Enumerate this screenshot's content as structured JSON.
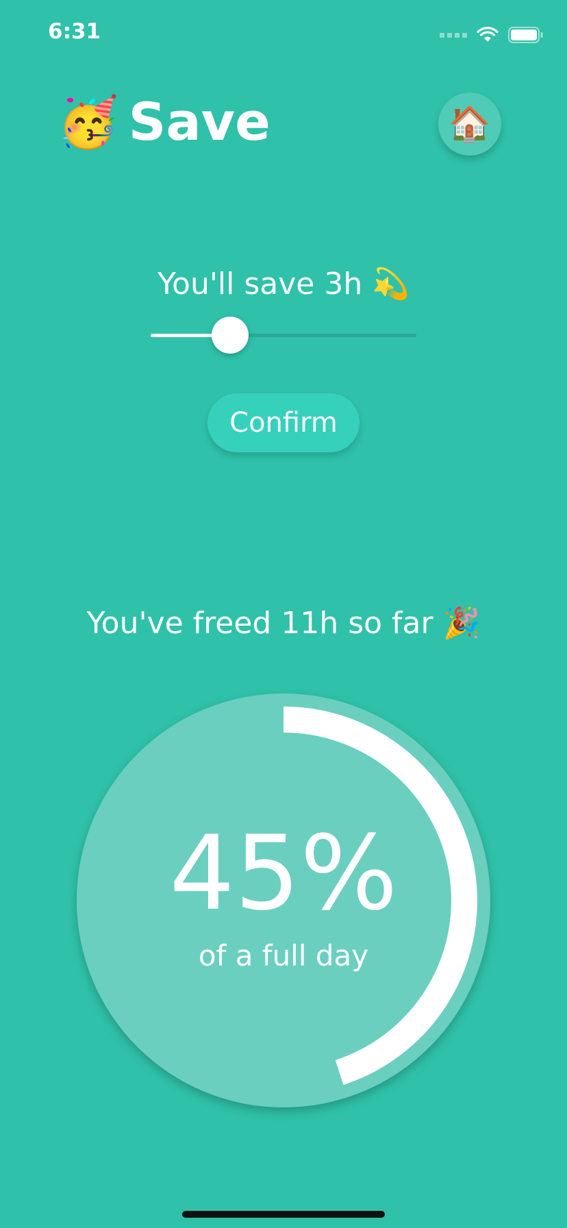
{
  "status_bar": {
    "time": "6:31",
    "signal_icon": "cellular-signal-icon",
    "wifi_icon": "wifi-icon",
    "battery_icon": "battery-icon"
  },
  "header": {
    "emoji": "🥳",
    "title": "Save",
    "home_button_emoji": "🏠"
  },
  "saver": {
    "label": "You'll save 3h 💫",
    "slider_value_fraction": 0.3,
    "confirm_label": "Confirm"
  },
  "progress": {
    "label": "You've freed 11h so far 🎉",
    "percent_text": "45%",
    "percent_value": 45,
    "caption": "of a full day"
  },
  "colors": {
    "background": "#2fc1a9",
    "circle_fill": "#6acfbf",
    "ring": "#ffffff",
    "button": "#35d1bb"
  }
}
